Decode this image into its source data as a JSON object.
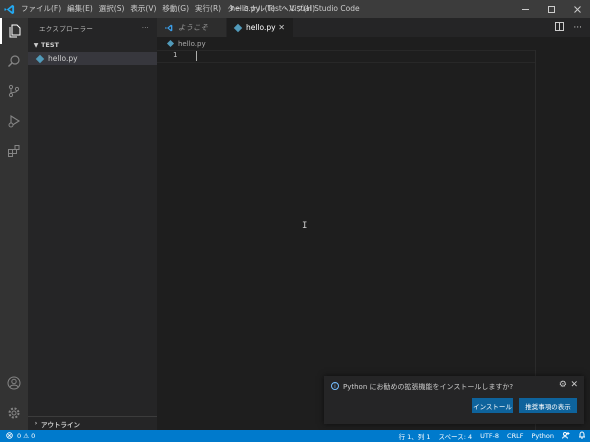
{
  "window": {
    "title": "hello.py - test - Visual Studio Code"
  },
  "menu": [
    "ファイル(F)",
    "編集(E)",
    "選択(S)",
    "表示(V)",
    "移動(G)",
    "実行(R)",
    "ターミナル(T)",
    "ヘルプ(H)"
  ],
  "sidebar": {
    "title": "エクスプローラー",
    "more": "···",
    "folder": "TEST",
    "files": [
      "hello.py"
    ],
    "outline": "アウトライン"
  },
  "tabs": [
    {
      "label": "ようこそ",
      "active": false
    },
    {
      "label": "hello.py",
      "active": true,
      "close": "✕"
    }
  ],
  "breadcrumb": "hello.py",
  "editor": {
    "line_numbers": [
      "1"
    ]
  },
  "notification": {
    "message": "Python にお勧めの拡張機能をインストールしますか?",
    "install_label": "インストール",
    "recommend_label": "推奨事項の表示"
  },
  "status": {
    "problems": "0 ⚠ 0",
    "position": "行 1、列 1",
    "spaces": "スペース: 4",
    "encoding": "UTF-8",
    "eol": "CRLF",
    "language": "Python"
  },
  "colors": {
    "accent": "#007acc",
    "button": "#0e639c",
    "python": "#519aba"
  }
}
